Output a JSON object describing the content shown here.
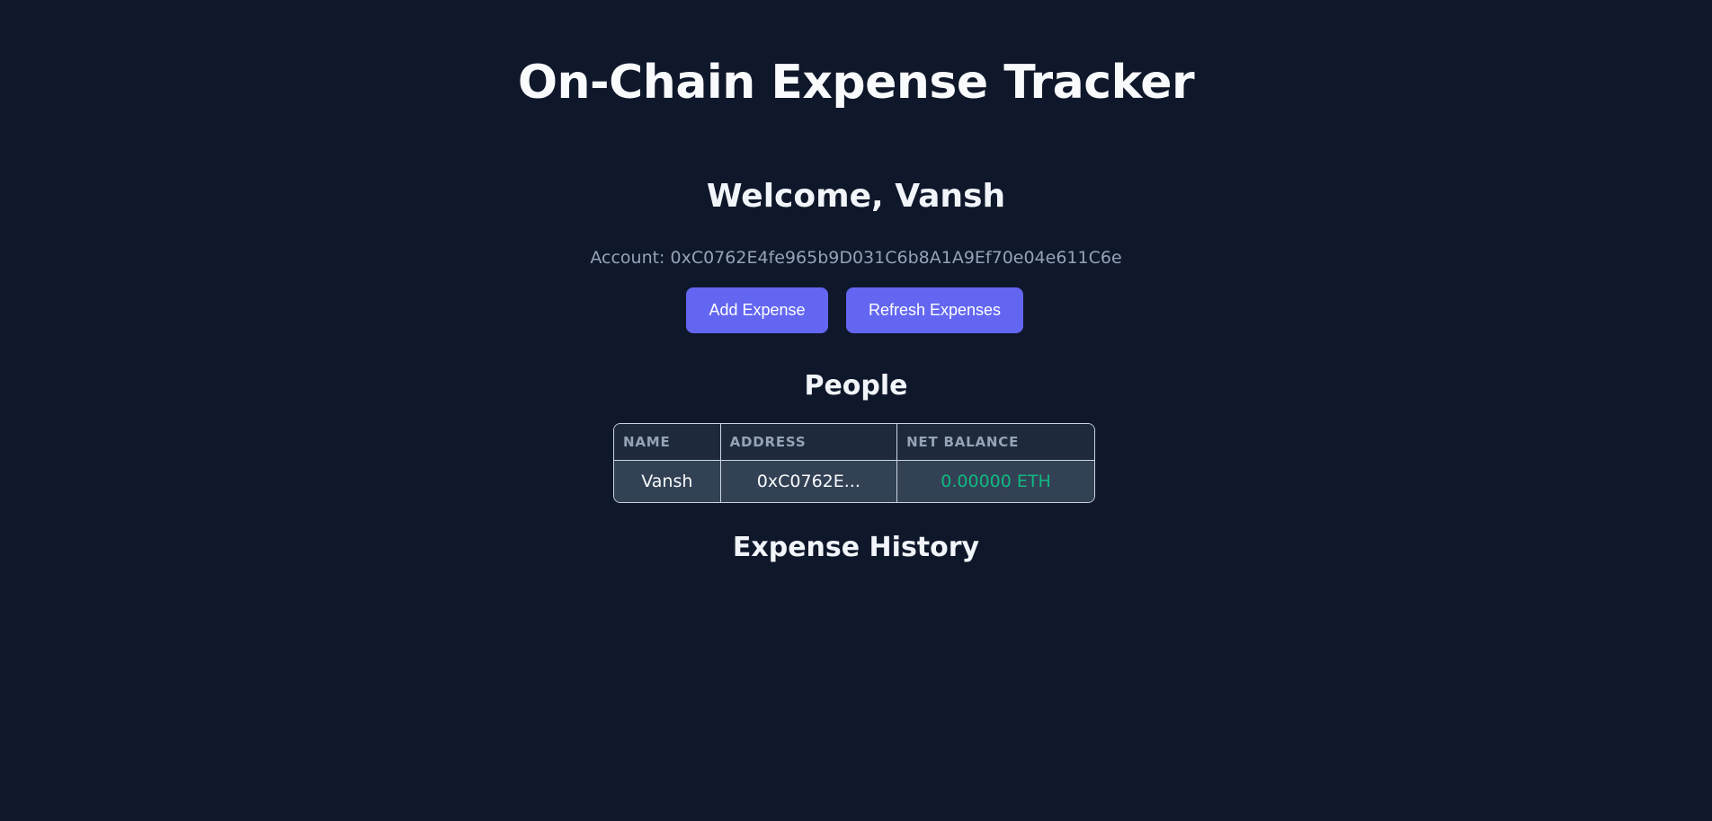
{
  "header": {
    "title": "On-Chain Expense Tracker"
  },
  "welcome": {
    "greeting": "Welcome, Vansh",
    "account": "Account: 0xC0762E4fe965b9D031C6b8A1A9Ef70e04e611C6e"
  },
  "actions": {
    "add_label": "Add Expense",
    "refresh_label": "Refresh Expenses"
  },
  "people": {
    "title": "People",
    "columns": [
      "NAME",
      "ADDRESS",
      "NET BALANCE"
    ],
    "rows": [
      {
        "name": "Vansh",
        "address": "0xC0762E...",
        "balance": "0.00000 ETH"
      }
    ]
  },
  "history": {
    "title": "Expense History"
  },
  "colors": {
    "background": "#0f172a",
    "accent": "#6366f1",
    "positive": "#10b981",
    "muted": "#94a3b8"
  }
}
